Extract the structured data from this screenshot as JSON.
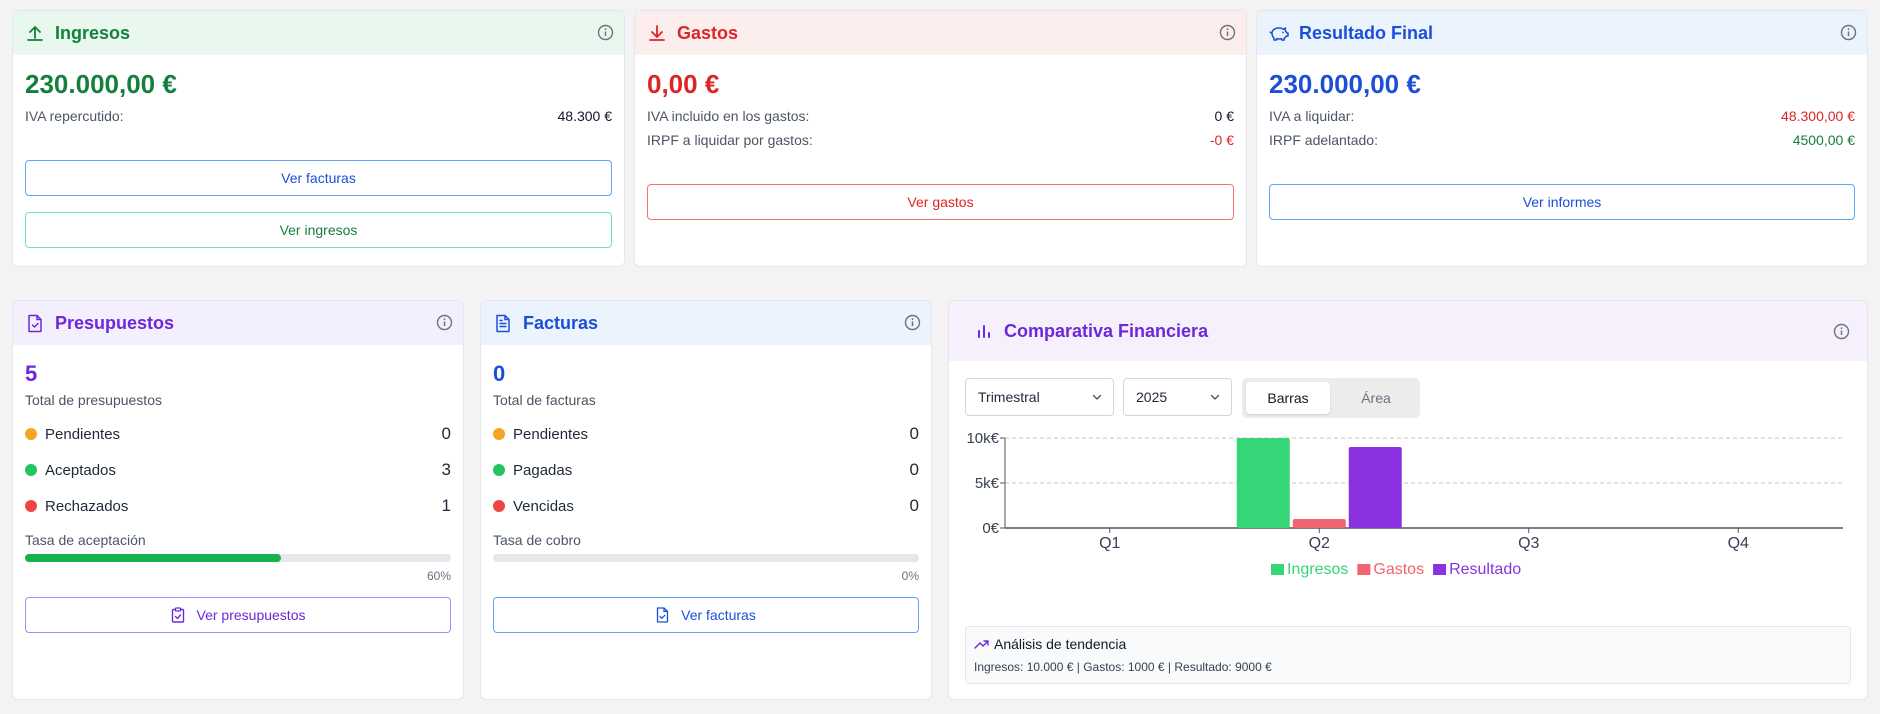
{
  "ingresos": {
    "title": "Ingresos",
    "amount": "230.000,00 €",
    "iva_label": "IVA repercutido:",
    "iva_value": "48.300 €",
    "btn_facturas": "Ver facturas",
    "btn_ingresos": "Ver ingresos"
  },
  "gastos": {
    "title": "Gastos",
    "amount": "0,00 €",
    "iva_label": "IVA incluido en los gastos:",
    "iva_value": "0 €",
    "irpf_label": "IRPF a liquidar por gastos:",
    "irpf_value": "-0 €",
    "btn_gastos": "Ver gastos"
  },
  "resultado": {
    "title": "Resultado Final",
    "amount": "230.000,00 €",
    "iva_label": "IVA a liquidar:",
    "iva_value": "48.300,00 €",
    "irpf_label": "IRPF adelantado:",
    "irpf_value": "4500,00 €",
    "btn_informes": "Ver informes"
  },
  "presupuestos": {
    "title": "Presupuestos",
    "total": "5",
    "total_label": "Total de presupuestos",
    "items": [
      {
        "label": "Pendientes",
        "count": "0"
      },
      {
        "label": "Aceptados",
        "count": "3"
      },
      {
        "label": "Rechazados",
        "count": "1"
      }
    ],
    "rate_label": "Tasa de aceptación",
    "rate_value": "60%",
    "rate_fraction": 0.6,
    "btn": "Ver presupuestos"
  },
  "facturas": {
    "title": "Facturas",
    "total": "0",
    "total_label": "Total de facturas",
    "items": [
      {
        "label": "Pendientes",
        "count": "0"
      },
      {
        "label": "Pagadas",
        "count": "0"
      },
      {
        "label": "Vencidas",
        "count": "0"
      }
    ],
    "rate_label": "Tasa de cobro",
    "rate_value": "0%",
    "rate_fraction": 0,
    "btn": "Ver facturas"
  },
  "comparativa": {
    "title": "Comparativa Financiera",
    "period_select": "Trimestral",
    "year_select": "2025",
    "toggle_bars": "Barras",
    "toggle_area": "Área",
    "trend_title": "Análisis de tendencia",
    "trend_text": "Ingresos: 10.000 € | Gastos: 1000 € | Resultado: 9000 €"
  },
  "colors": {
    "green": "#15803d",
    "red": "#dc2626",
    "blue": "#1d4ed8",
    "purple": "#6d28d9",
    "ingresos_series": "#34d678",
    "gastos_series": "#f06471",
    "resultado_series": "#8b32e0"
  },
  "chart_data": {
    "type": "bar",
    "categories": [
      "Q1",
      "Q2",
      "Q3",
      "Q4"
    ],
    "series": [
      {
        "name": "Ingresos",
        "values": [
          0,
          10000,
          0,
          0
        ],
        "color": "#34d678"
      },
      {
        "name": "Gastos",
        "values": [
          0,
          1000,
          0,
          0
        ],
        "color": "#f06471"
      },
      {
        "name": "Resultado",
        "values": [
          0,
          9000,
          0,
          0
        ],
        "color": "#8b32e0"
      }
    ],
    "y_ticks": [
      "0€",
      "5k€",
      "10k€"
    ],
    "ylim": [
      0,
      10000
    ],
    "grid": true,
    "legend": "bottom"
  }
}
